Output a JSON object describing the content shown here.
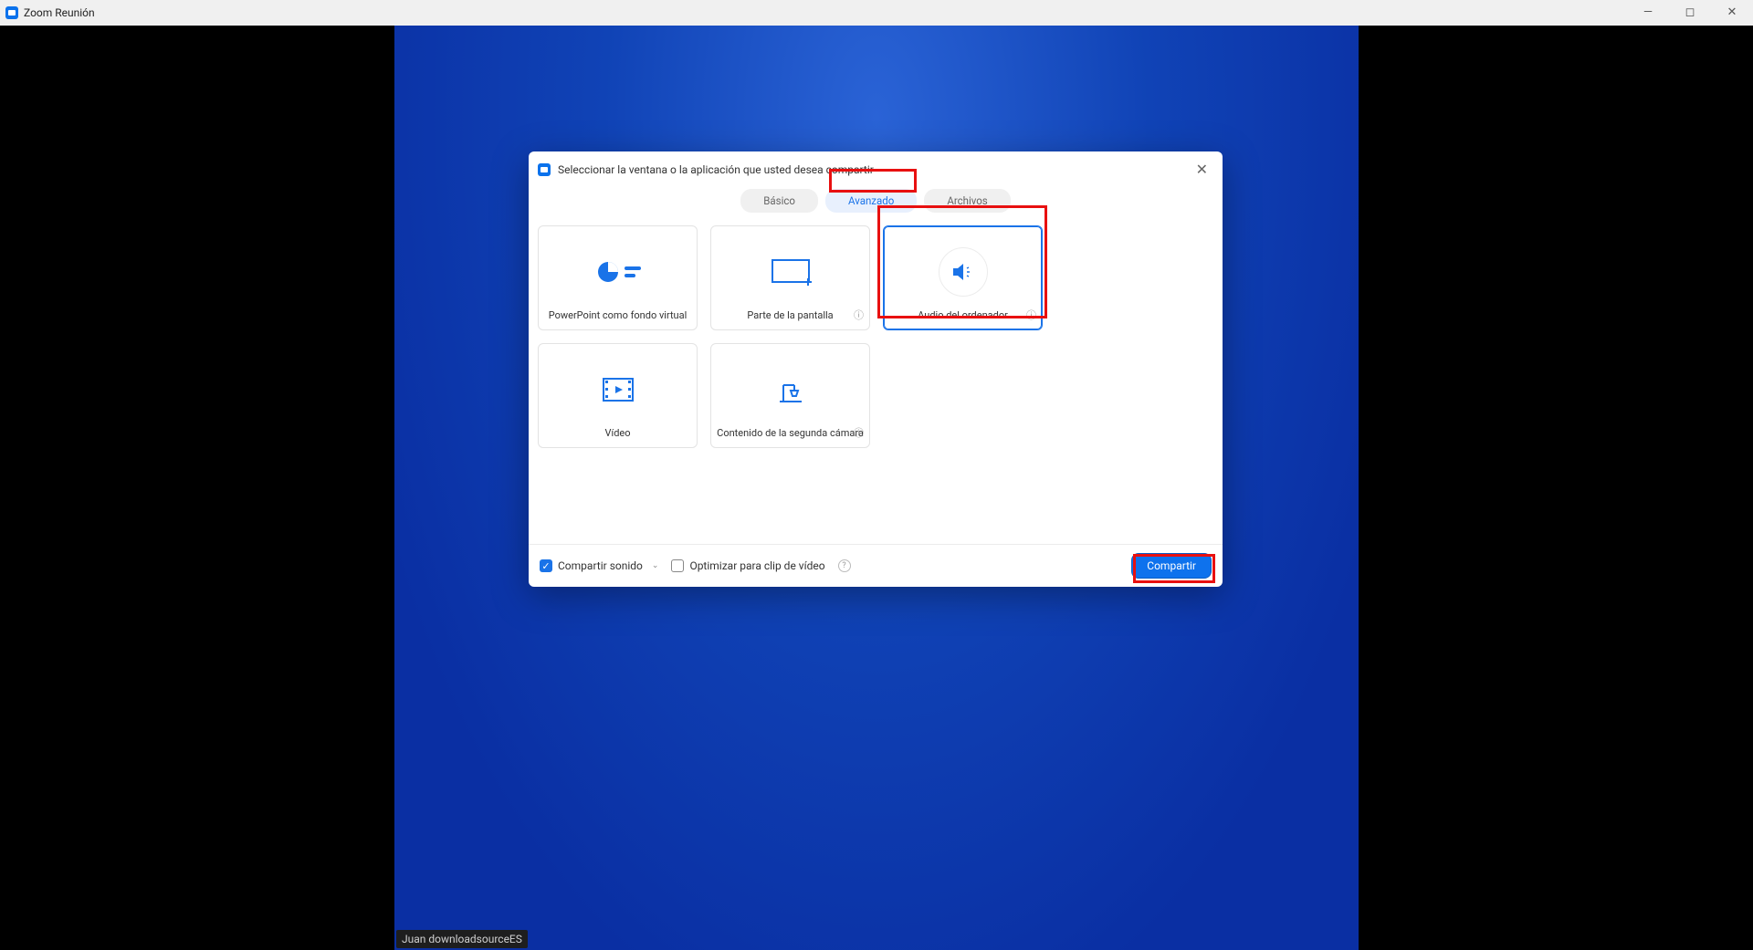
{
  "window": {
    "title": "Zoom Reunión"
  },
  "participant_name": "Juan downloadsourceES",
  "dialog": {
    "title": "Seleccionar la ventana o la aplicación que usted desea compartir",
    "tabs": {
      "basic": "Básico",
      "advanced": "Avanzado",
      "files": "Archivos"
    },
    "cards": {
      "ppt": "PowerPoint como fondo virtual",
      "portion": "Parte de la pantalla",
      "audio": "Audio del ordenador",
      "video": "Vídeo",
      "second_cam": "Contenido de la segunda cámara"
    },
    "footer": {
      "share_sound": "Compartir sonido",
      "optimize_clip": "Optimizar para clip de vídeo",
      "share_button": "Compartir"
    }
  }
}
